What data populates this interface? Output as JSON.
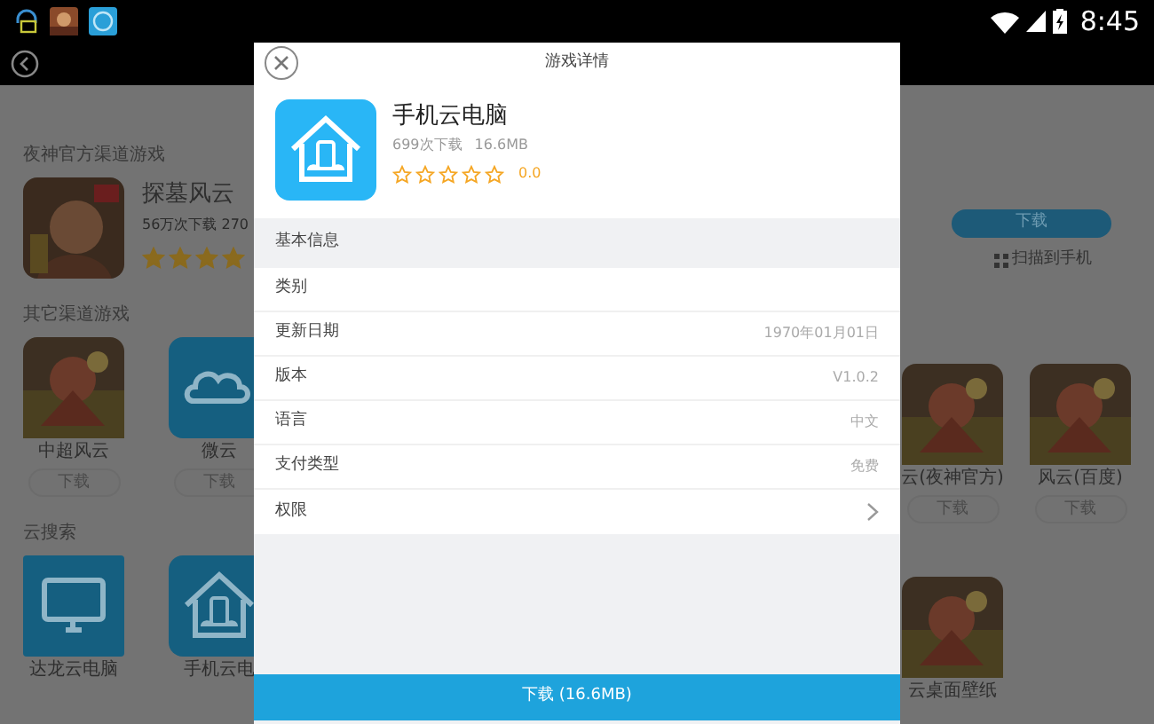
{
  "status_bar": {
    "time": "8:45"
  },
  "background": {
    "sections": [
      {
        "kind": "featured",
        "title": "夜神官方渠道游戏",
        "app": {
          "name": "探墓风云",
          "meta": "56万次下载  270",
          "stars": 4
        }
      },
      {
        "kind": "tiles",
        "title": "其它渠道游戏",
        "tiles": [
          {
            "name": "中超风云",
            "button": "下载",
            "kind": "picture"
          },
          {
            "name": "微云",
            "button": "下载",
            "kind": "cloud"
          }
        ]
      },
      {
        "kind": "tiles",
        "title": "云搜索",
        "tiles": [
          {
            "name": "达龙云电脑",
            "kind": "monitor"
          },
          {
            "name": "手机云电",
            "kind": "house"
          }
        ]
      }
    ],
    "right": {
      "download_button": "下载",
      "scan_link": "扫描到手机",
      "tiles": [
        {
          "name": "云(夜神官方)",
          "button": "下载",
          "kind": "picture"
        },
        {
          "name": "风云(百度)",
          "button": "下载",
          "kind": "picture"
        }
      ],
      "bottom_tiles": [
        {
          "name": "云桌面壁纸",
          "kind": "picture"
        }
      ]
    }
  },
  "dialog": {
    "title": "游戏详情",
    "app": {
      "name": "手机云电脑",
      "downloads": "699次下载",
      "size": "16.6MB",
      "stars": 0,
      "rating": "0.0"
    },
    "section_title": "基本信息",
    "rows": [
      {
        "label": "类别",
        "kind": "text"
      },
      {
        "label": "更新日期",
        "value": "1970年01月01日",
        "kind": "text"
      },
      {
        "label": "版本",
        "value": "V1.0.2",
        "kind": "text"
      },
      {
        "label": "语言",
        "value": "中文",
        "kind": "text"
      },
      {
        "label": "支付类型",
        "value": "免费",
        "kind": "text"
      },
      {
        "label": "权限",
        "kind": "link"
      }
    ],
    "download_button": "下载 (16.6MB)"
  }
}
